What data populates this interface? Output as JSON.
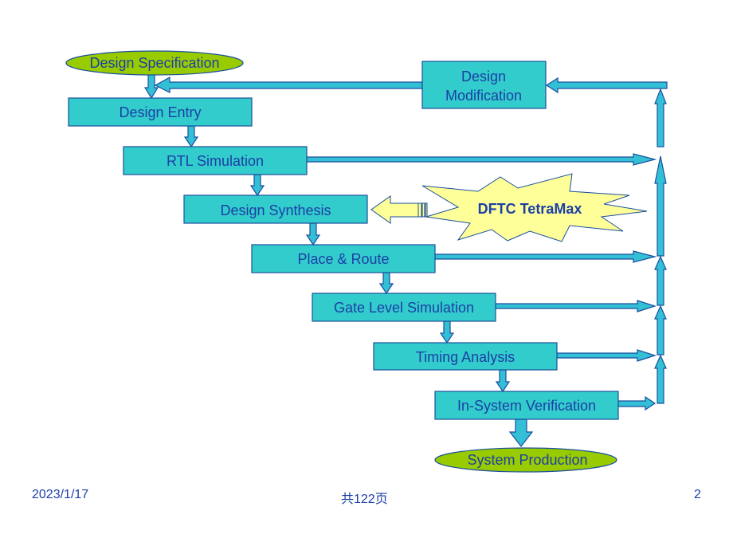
{
  "colors": {
    "box_fill": "#33cccc",
    "box_stroke": "#1a4f9c",
    "ellipse_fill": "#99cc00",
    "star_fill": "#ffff99",
    "arrow_fill": "#33bfd6",
    "text": "#1c3fa6"
  },
  "flow": {
    "start": "Design Specification",
    "steps": [
      "Design Entry",
      "RTL Simulation",
      "Design Synthesis",
      "Place & Route",
      "Gate Level Simulation",
      "Timing Analysis",
      "In-System Verification"
    ],
    "end": "System Production",
    "modification": [
      "Design",
      "Modification"
    ],
    "tool": "DFTC  TetraMax"
  },
  "footer": {
    "date": "2023/1/17",
    "pages": "共122页",
    "page_number": "2"
  }
}
